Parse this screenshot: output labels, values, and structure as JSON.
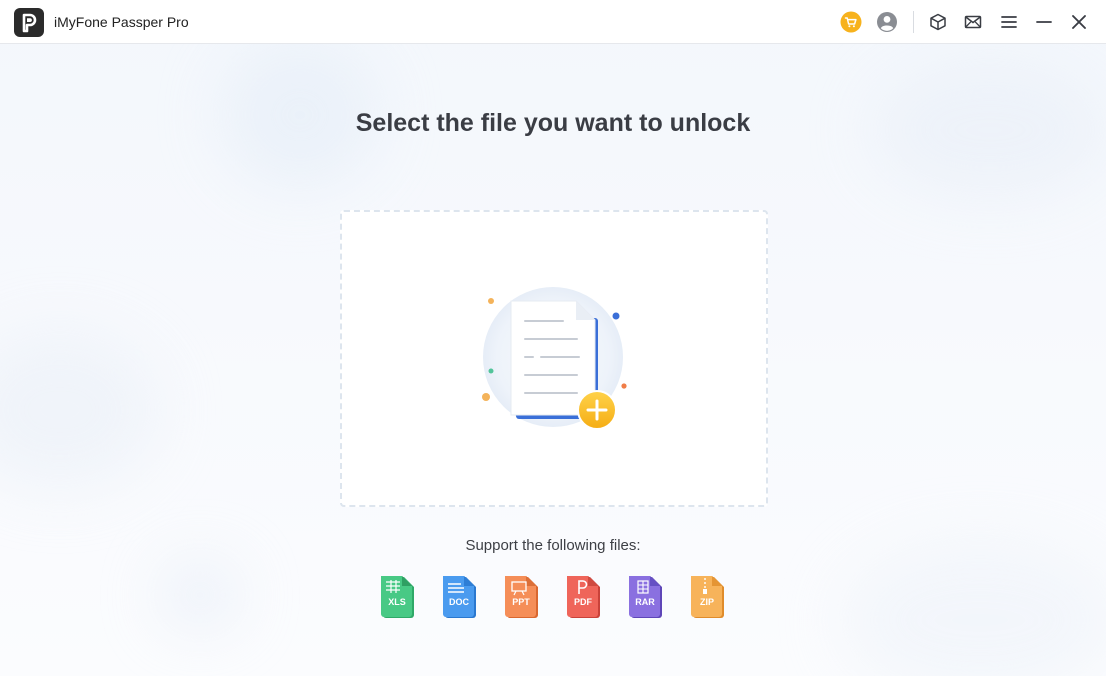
{
  "app": {
    "title": "iMyFone Passper Pro",
    "logo_letter": "P"
  },
  "toolbar": {
    "icons": [
      "cart-icon",
      "account-icon",
      "cube-icon",
      "mail-icon",
      "menu-icon",
      "minimize-icon",
      "close-icon"
    ]
  },
  "main": {
    "heading": "Select the file you want to unlock",
    "support_label": "Support the following files:"
  },
  "file_types": [
    {
      "label": "XLS",
      "color": "#3fbf7a"
    },
    {
      "label": "DOC",
      "color": "#3d8fe6"
    },
    {
      "label": "PPT",
      "color": "#f0844d"
    },
    {
      "label": "PDF",
      "color": "#ea5a4e"
    },
    {
      "label": "RAR",
      "color": "#7b62d6"
    },
    {
      "label": "ZIP",
      "color": "#f2a947"
    }
  ],
  "colors": {
    "accent_yellow": "#f7b21d",
    "accent_blue": "#3a6fd8"
  }
}
